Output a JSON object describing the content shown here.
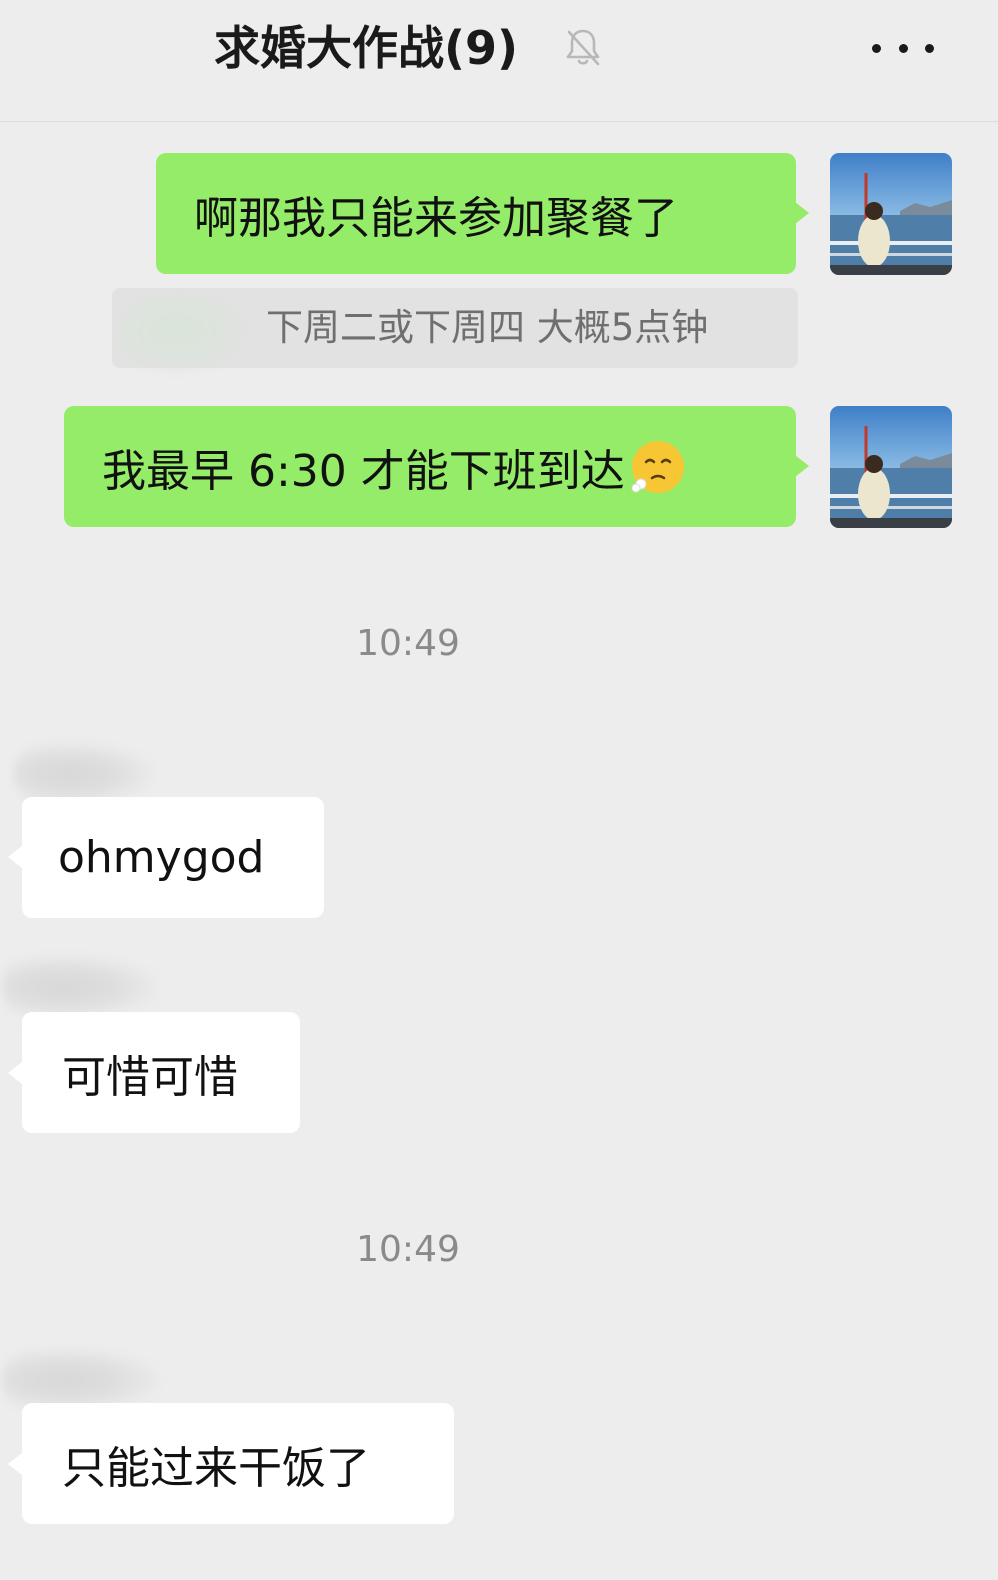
{
  "header": {
    "title": "求婚大作战(9)",
    "mute_icon": "bell-slash-icon",
    "more_icon": "more-horizontal-icon"
  },
  "colors": {
    "background": "#ededed",
    "sent_bubble": "#95ec69",
    "received_bubble": "#ffffff",
    "quote_bg": "#e2e2e2",
    "timestamp": "#8a8a8a"
  },
  "messages": {
    "m1": {
      "text": "啊那我只能来参加聚餐了",
      "direction": "sent"
    },
    "quote": {
      "text": "下周二或下周四 大概5点钟"
    },
    "m2": {
      "text": "我最早 6:30 才能下班到达",
      "direction": "sent",
      "emoji": "face-exhaling-emoji"
    },
    "time1": "10:49",
    "m3": {
      "text": "ohmygod",
      "direction": "received"
    },
    "m4": {
      "text": "可惜可惜",
      "direction": "received"
    },
    "time2": "10:49",
    "m5": {
      "text": "只能过来干饭了",
      "direction": "received"
    }
  }
}
